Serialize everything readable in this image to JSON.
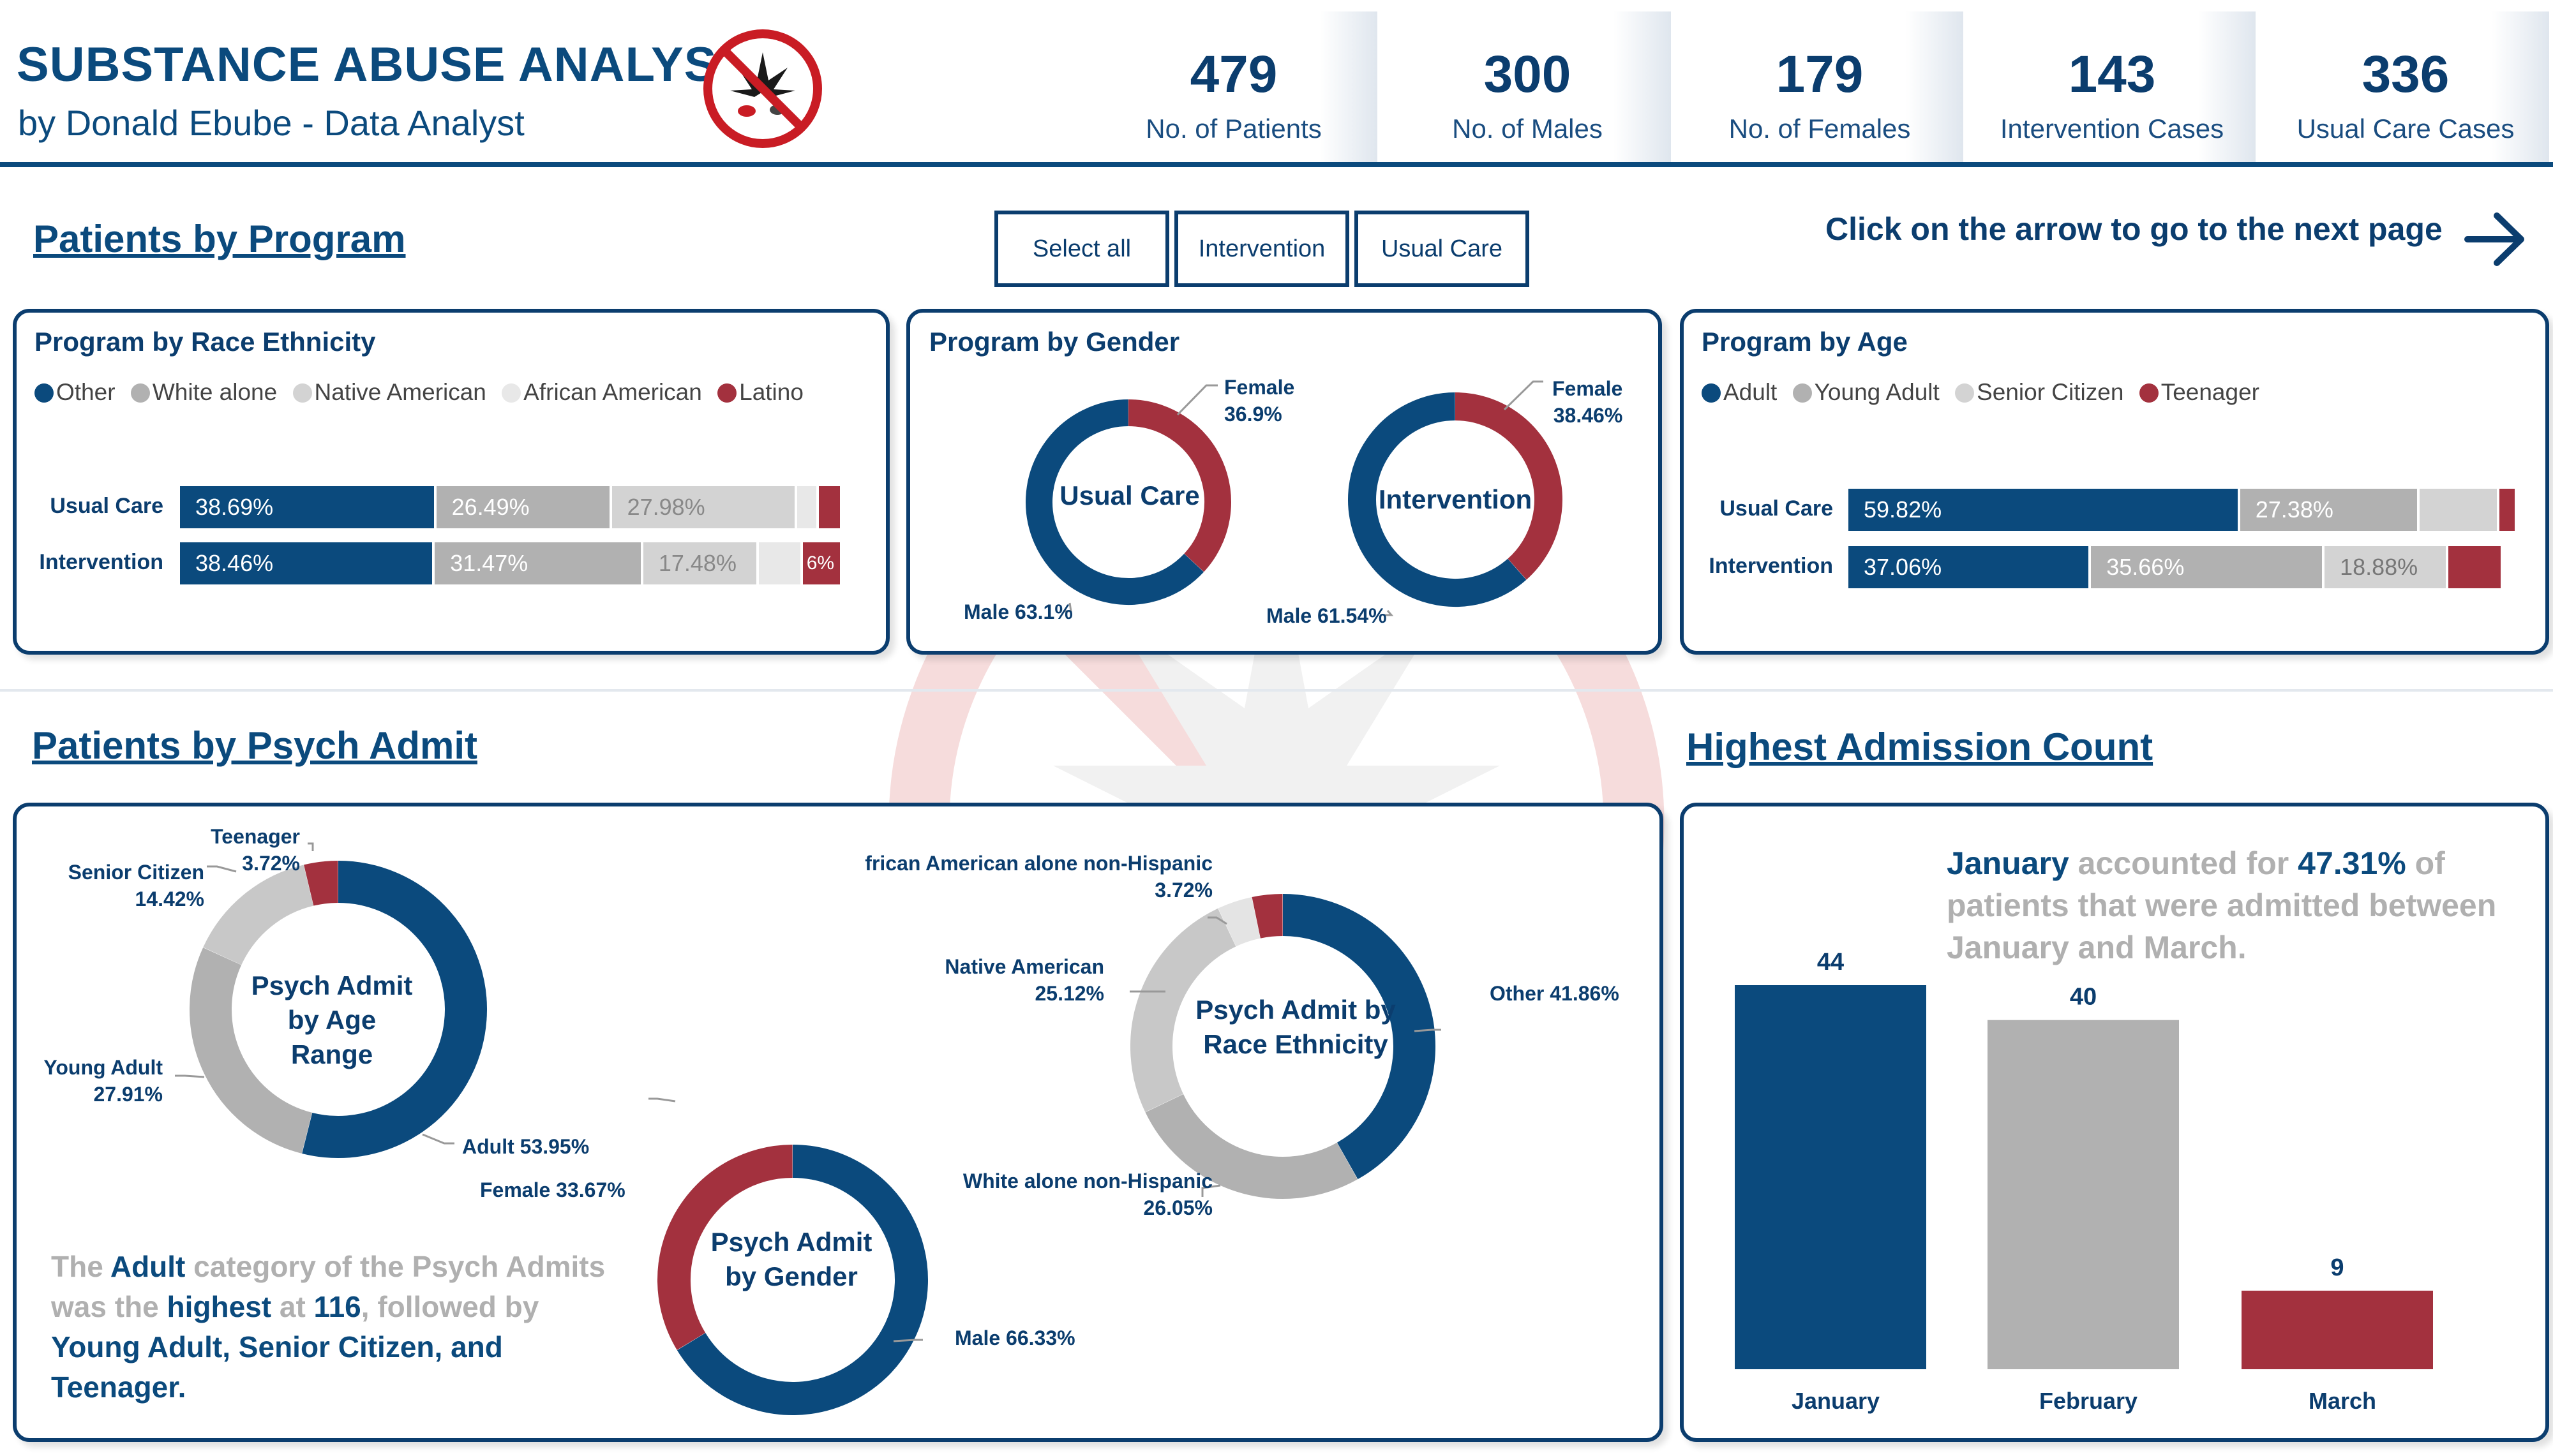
{
  "header": {
    "title": "SUBSTANCE ABUSE ANALYSIS",
    "subtitle": "by Donald Ebube - Data Analyst",
    "kpis": [
      {
        "value": "479",
        "label": "No. of Patients"
      },
      {
        "value": "300",
        "label": "No. of Males"
      },
      {
        "value": "179",
        "label": "No. of Females"
      },
      {
        "value": "143",
        "label": "Intervention Cases"
      },
      {
        "value": "336",
        "label": "Usual Care Cases"
      }
    ]
  },
  "section_program": {
    "title": "Patients by Program",
    "slicers": [
      "Select all",
      "Intervention",
      "Usual Care"
    ],
    "next_page_text": "Click on the arrow to go to the next page"
  },
  "colors": {
    "navy": "#0b4a7d",
    "gray": "#b1b1b1",
    "light_gray": "#d3d3d3",
    "very_light": "#e8e8e8",
    "red": "#a3313e"
  },
  "section_psych": {
    "title": "Patients by Psych Admit"
  },
  "section_admission": {
    "title": "Highest Admission Count"
  },
  "chart_data": [
    {
      "type": "bar",
      "title": "Program by Race Ethnicity",
      "orientation": "horizontal-stacked-100",
      "legend": [
        "Other",
        "White alone",
        "Native American",
        "African American",
        "Latino"
      ],
      "categories": [
        "Usual Care",
        "Intervention"
      ],
      "series": [
        {
          "name": "Other",
          "values": [
            38.69,
            38.46
          ],
          "labels": [
            "38.69%",
            "38.46%"
          ]
        },
        {
          "name": "White alone",
          "values": [
            26.49,
            31.47
          ],
          "labels": [
            "26.49%",
            "31.47%"
          ]
        },
        {
          "name": "Native American",
          "values": [
            27.98,
            17.48
          ],
          "labels": [
            "27.98%",
            "17.48%"
          ]
        },
        {
          "name": "African American",
          "values": [
            3.27,
            6.59
          ],
          "labels": [
            "",
            ""
          ]
        },
        {
          "name": "Latino",
          "values": [
            3.57,
            6.0
          ],
          "labels": [
            "",
            "6%"
          ]
        }
      ]
    },
    {
      "type": "pie",
      "title": "Program by Gender",
      "donuts": [
        {
          "center": "Usual Care",
          "slices": [
            {
              "name": "Male",
              "value": 63.1,
              "label": "Male 63.1%"
            },
            {
              "name": "Female",
              "value": 36.9,
              "label_name": "Female",
              "label_value": "36.9%"
            }
          ]
        },
        {
          "center": "Intervention",
          "slices": [
            {
              "name": "Male",
              "value": 61.54,
              "label": "Male 61.54%"
            },
            {
              "name": "Female",
              "value": 38.46,
              "label_name": "Female",
              "label_value": "38.46%"
            }
          ]
        }
      ]
    },
    {
      "type": "bar",
      "title": "Program by Age",
      "orientation": "horizontal-stacked-100",
      "legend": [
        "Adult",
        "Young Adult",
        "Senior Citizen",
        "Teenager"
      ],
      "categories": [
        "Usual Care",
        "Intervention"
      ],
      "series": [
        {
          "name": "Adult",
          "values": [
            59.82,
            37.06
          ],
          "labels": [
            "59.82%",
            "37.06%"
          ]
        },
        {
          "name": "Young Adult",
          "values": [
            27.38,
            35.66
          ],
          "labels": [
            "27.38%",
            "35.66%"
          ]
        },
        {
          "name": "Senior Citizen",
          "values": [
            12.2,
            18.88
          ],
          "labels": [
            "",
            "18.88%"
          ]
        },
        {
          "name": "Teenager",
          "values": [
            0.6,
            8.4
          ],
          "labels": [
            "",
            ""
          ]
        }
      ]
    },
    {
      "type": "pie",
      "center": "Psych Admit by Age Range",
      "slices": [
        {
          "name": "Adult",
          "value": 53.95,
          "label_name": "Adult 53.95%"
        },
        {
          "name": "Young Adult",
          "value": 27.91,
          "label_name": "Young Adult",
          "label_value": "27.91%"
        },
        {
          "name": "Senior Citizen",
          "value": 14.42,
          "label_name": "Senior Citizen",
          "label_value": "14.42%"
        },
        {
          "name": "Teenager",
          "value": 3.72,
          "label_name": "Teenager",
          "label_value": "3.72%"
        }
      ]
    },
    {
      "type": "pie",
      "center": "Psych Admit by Gender",
      "slices": [
        {
          "name": "Male",
          "value": 66.33,
          "label_name": "Male 66.33%"
        },
        {
          "name": "Female",
          "value": 33.67,
          "label_name": "Female 33.67%"
        }
      ]
    },
    {
      "type": "pie",
      "center": "Psych Admit by Race Ethnicity",
      "slices": [
        {
          "name": "Other",
          "value": 41.86,
          "label_name": "Other 41.86%"
        },
        {
          "name": "White alone non-Hispanic",
          "value": 26.05,
          "label_name": "White alone non-Hispanic",
          "label_value": "26.05%"
        },
        {
          "name": "Native American",
          "value": 25.12,
          "label_name": "Native American",
          "label_value": "25.12%"
        },
        {
          "name": "African American alone non-Hispanic",
          "value": 3.72,
          "label_name": "frican American alone non-Hispanic",
          "label_value": "3.72%"
        },
        {
          "name": "Latino",
          "value": 3.25,
          "label_name": ""
        }
      ]
    },
    {
      "type": "bar",
      "categories": [
        "January",
        "February",
        "March"
      ],
      "values": [
        44,
        40,
        9
      ]
    }
  ],
  "psych_note": {
    "p1": "The ",
    "k1": "Adult",
    "p2": " category of the Psych Admits",
    "p3": "was the ",
    "k2": "highest",
    "p4": " at ",
    "k3": "116",
    "p5": ", followed by",
    "k4": "Young Adult, Senior Citizen, and",
    "k5": "Teenager."
  },
  "admission_note": {
    "k1": "January",
    "p1": " accounted for ",
    "k2": "47.31%",
    "p2": " of",
    "line2": "patients that were admitted between",
    "line3": "January and March."
  }
}
